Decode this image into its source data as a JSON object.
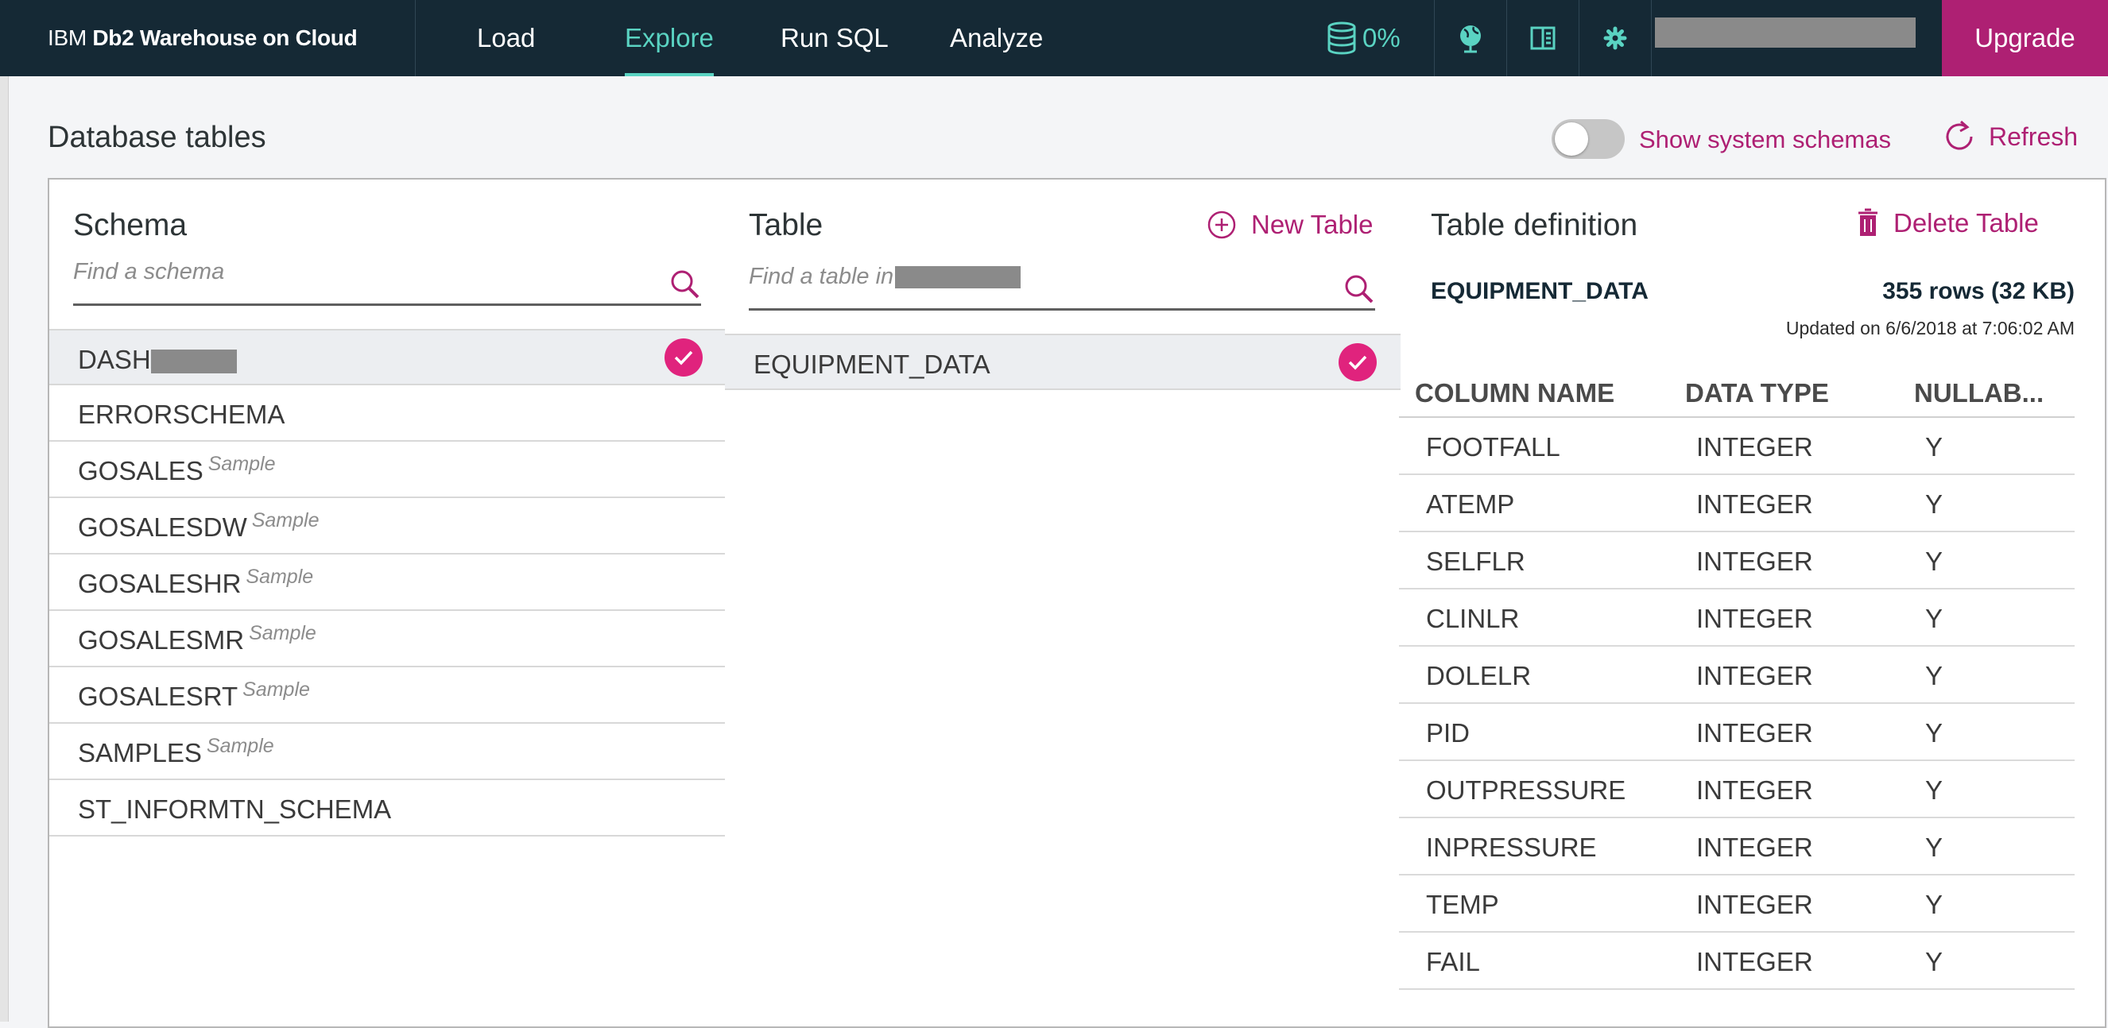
{
  "app": {
    "brand_prefix": "IBM ",
    "brand_name": "Db2 Warehouse on Cloud"
  },
  "nav": {
    "items": [
      {
        "label": "Load",
        "active": false
      },
      {
        "label": "Explore",
        "active": true
      },
      {
        "label": "Run SQL",
        "active": false
      },
      {
        "label": "Analyze",
        "active": false
      }
    ],
    "storage_usage": "0%",
    "icons": [
      "database-icon",
      "globe-icon",
      "book-icon",
      "gear-icon"
    ],
    "upgrade_label": "Upgrade"
  },
  "header": {
    "title": "Database tables",
    "system_schemas_toggle": {
      "label": "Show system schemas",
      "on": false
    },
    "refresh_label": "Refresh"
  },
  "schema_panel": {
    "title": "Schema",
    "search_placeholder": "Find a schema",
    "items": [
      {
        "name": "DASH",
        "tag": "",
        "selected": true
      },
      {
        "name": "ERRORSCHEMA",
        "tag": "",
        "selected": false
      },
      {
        "name": "GOSALES",
        "tag": "Sample",
        "selected": false
      },
      {
        "name": "GOSALESDW",
        "tag": "Sample",
        "selected": false
      },
      {
        "name": "GOSALESHR",
        "tag": "Sample",
        "selected": false
      },
      {
        "name": "GOSALESMR",
        "tag": "Sample",
        "selected": false
      },
      {
        "name": "GOSALESRT",
        "tag": "Sample",
        "selected": false
      },
      {
        "name": "SAMPLES",
        "tag": "Sample",
        "selected": false
      },
      {
        "name": "ST_INFORMTN_SCHEMA",
        "tag": "",
        "selected": false
      }
    ]
  },
  "table_panel": {
    "title": "Table",
    "new_table_label": "New Table",
    "search_placeholder": "Find a table in",
    "items": [
      {
        "name": "EQUIPMENT_DATA",
        "selected": true
      }
    ]
  },
  "definition_panel": {
    "title": "Table definition",
    "delete_label": "Delete Table",
    "table_name": "EQUIPMENT_DATA",
    "row_info": "355 rows (32 KB)",
    "updated": "Updated on 6/6/2018 at 7:06:02 AM",
    "columns_header": [
      "COLUMN NAME",
      "DATA TYPE",
      "NULLAB..."
    ],
    "columns": [
      [
        "FOOTFALL",
        "INTEGER",
        "Y"
      ],
      [
        "ATEMP",
        "INTEGER",
        "Y"
      ],
      [
        "SELFLR",
        "INTEGER",
        "Y"
      ],
      [
        "CLINLR",
        "INTEGER",
        "Y"
      ],
      [
        "DOLELR",
        "INTEGER",
        "Y"
      ],
      [
        "PID",
        "INTEGER",
        "Y"
      ],
      [
        "OUTPRESSURE",
        "INTEGER",
        "Y"
      ],
      [
        "INPRESSURE",
        "INTEGER",
        "Y"
      ],
      [
        "TEMP",
        "INTEGER",
        "Y"
      ],
      [
        "FAIL",
        "INTEGER",
        "Y"
      ]
    ]
  },
  "colors": {
    "topbar": "#152935",
    "accent_teal": "#5ad3c2",
    "accent_magenta": "#ae2073",
    "check_pink": "#e0237d"
  }
}
